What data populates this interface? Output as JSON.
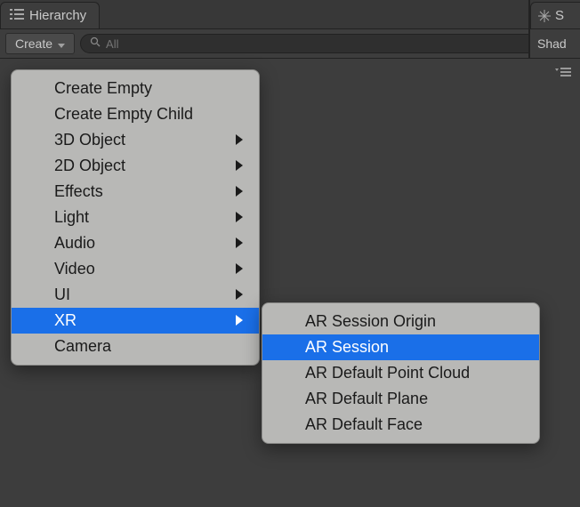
{
  "hierarchy_panel": {
    "tab_label": "Hierarchy",
    "create_button_label": "Create",
    "search_placeholder": "All"
  },
  "scene_panel": {
    "tab_label_fragment": "S",
    "toolbar_label_fragment": "Shad"
  },
  "context_menu": {
    "items": [
      {
        "label": "Create Empty",
        "has_submenu": false
      },
      {
        "label": "Create Empty Child",
        "has_submenu": false
      },
      {
        "label": "3D Object",
        "has_submenu": true
      },
      {
        "label": "2D Object",
        "has_submenu": true
      },
      {
        "label": "Effects",
        "has_submenu": true
      },
      {
        "label": "Light",
        "has_submenu": true
      },
      {
        "label": "Audio",
        "has_submenu": true
      },
      {
        "label": "Video",
        "has_submenu": true
      },
      {
        "label": "UI",
        "has_submenu": true
      },
      {
        "label": "XR",
        "has_submenu": true,
        "highlighted": true
      },
      {
        "label": "Camera",
        "has_submenu": false
      }
    ],
    "submenu": {
      "parent": "XR",
      "items": [
        {
          "label": "AR Session Origin"
        },
        {
          "label": "AR Session",
          "highlighted": true
        },
        {
          "label": "AR Default Point Cloud"
        },
        {
          "label": "AR Default Plane"
        },
        {
          "label": "AR Default Face"
        }
      ]
    }
  },
  "colors": {
    "highlight": "#1a6fe8",
    "menu_bg": "#b8b8b6",
    "panel_bg": "#3d3d3d"
  }
}
